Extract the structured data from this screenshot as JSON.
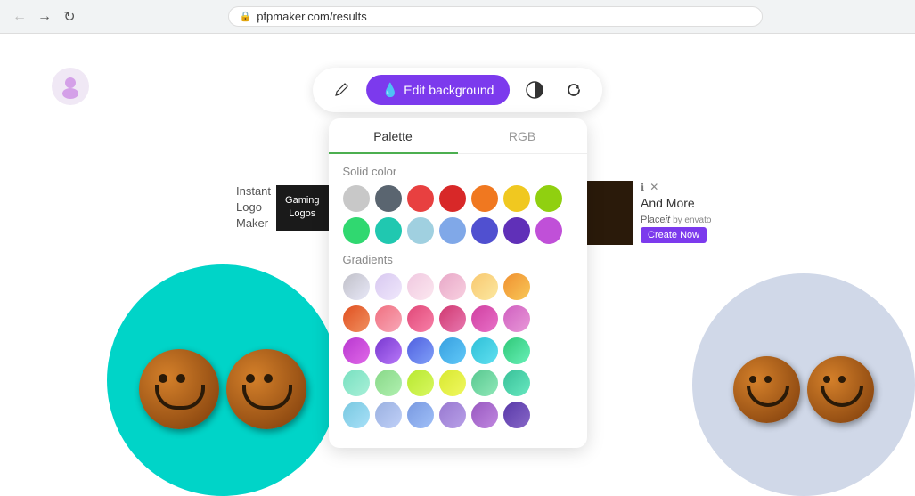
{
  "browser": {
    "url": "pfpmaker.com/results",
    "back_disabled": false,
    "forward_disabled": false
  },
  "toolbar": {
    "edit_background_label": "Edit background",
    "pencil_icon": "✏",
    "water_drop_icon": "💧",
    "contrast_icon": "◐",
    "refresh_icon": "↺"
  },
  "color_panel": {
    "tab_palette": "Palette",
    "tab_rgb": "RGB",
    "active_tab": "Palette",
    "solid_color_label": "Solid color",
    "gradients_label": "Gradients",
    "solid_colors": [
      "#c8c8c8",
      "#6b6b6b",
      "#e84040",
      "#e83030",
      "#f07020",
      "#f0c020",
      "#90c820",
      "#40c870",
      "#40d0b0",
      "#60c0d0",
      "#a0c0e8",
      "#6080d0",
      "#7040c0",
      "#c060d0"
    ],
    "gradient_rows": [
      [
        "#c0c0c8,#e0e0f0",
        "#d0c8e8,#f0e8f8",
        "#e8c8d8,#f8e0e8",
        "#e0a8c0,#f0c8d8",
        "#f0c080,#f8e0a0",
        "#f0a040,#f8c060"
      ],
      [
        "#e05020,#f08040",
        "#f08090,#f0a0b0",
        "#e06080,#f090a0",
        "#d04070,#e870a0",
        "#d040a0,#e870c0",
        "#d060c0,#e890d8"
      ],
      [
        "#c040d0,#e070e8",
        "#8040d0,#c080f0",
        "#6060e0,#80a0f8",
        "#40a0e0,#60c0f8",
        "#40c0d8,#60e0f0",
        "#40d080,#70f0c0"
      ],
      [
        "#80e0c0,#a0f0d8",
        "#90d890,#b0f0b0",
        "#c0e840,#e0f870",
        "#e0e840,#f8f880",
        "#60c890,#90e8b8",
        "#40c0a0,#70e8c0"
      ],
      [
        "#80c8e0,#a0e0f8",
        "#a0b8e0,#c0d0f8",
        "#80a0e0,#a0c0f8",
        "#9080d0,#b0a0e8",
        "#a060c0,#c090e0",
        "#6040b0,#9070d0"
      ]
    ]
  },
  "ad": {
    "instant_logo_text": "Instant\nLogo\nMaker",
    "gaming_logos_text": "Gaming\nLogos",
    "and_more_text": "And More",
    "placeit_text": "Place it by envato",
    "create_now_label": "Create Now",
    "info_icon": "ℹ",
    "close_icon": "✕"
  },
  "user_avatar": {
    "icon": "👤"
  }
}
